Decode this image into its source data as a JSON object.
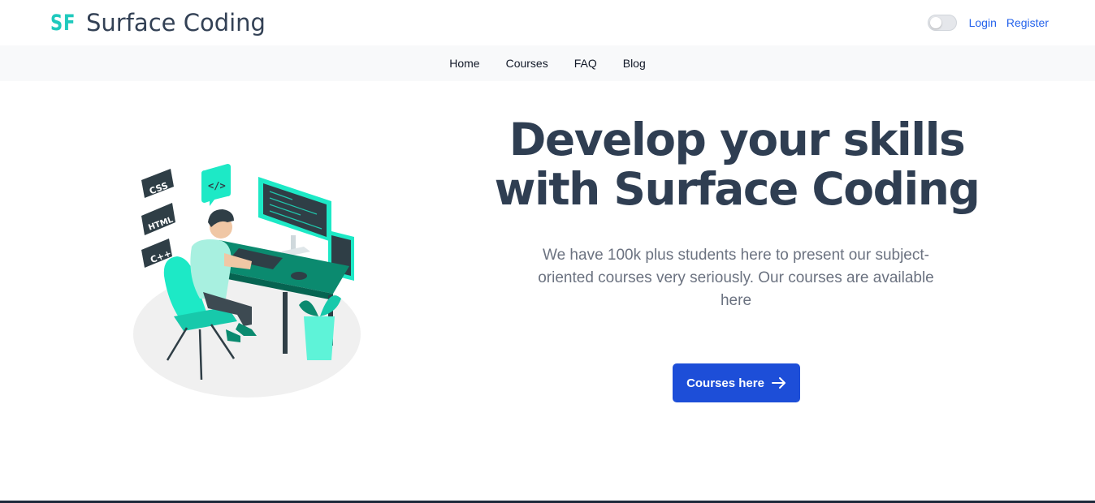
{
  "brand": {
    "mark": "SF",
    "name": "Surface Coding",
    "accent": "#1fc9bd"
  },
  "auth": {
    "login": "Login",
    "register": "Register",
    "dark_mode_on": false
  },
  "nav": {
    "items": [
      "Home",
      "Courses",
      "FAQ",
      "Blog"
    ]
  },
  "hero": {
    "title": "Develop your skills with Surface Coding",
    "subtitle": "We have 100k plus students here to present our subject-oriented courses very seriously. Our courses are available here",
    "cta_label": "Courses here",
    "illustration_tags": [
      "CSS",
      "HTML",
      "C++",
      "</>"
    ]
  },
  "colors": {
    "primary": "#1d4ed8",
    "link": "#2563eb",
    "heading": "#2f3e52",
    "illustration": "#1de9c6"
  }
}
